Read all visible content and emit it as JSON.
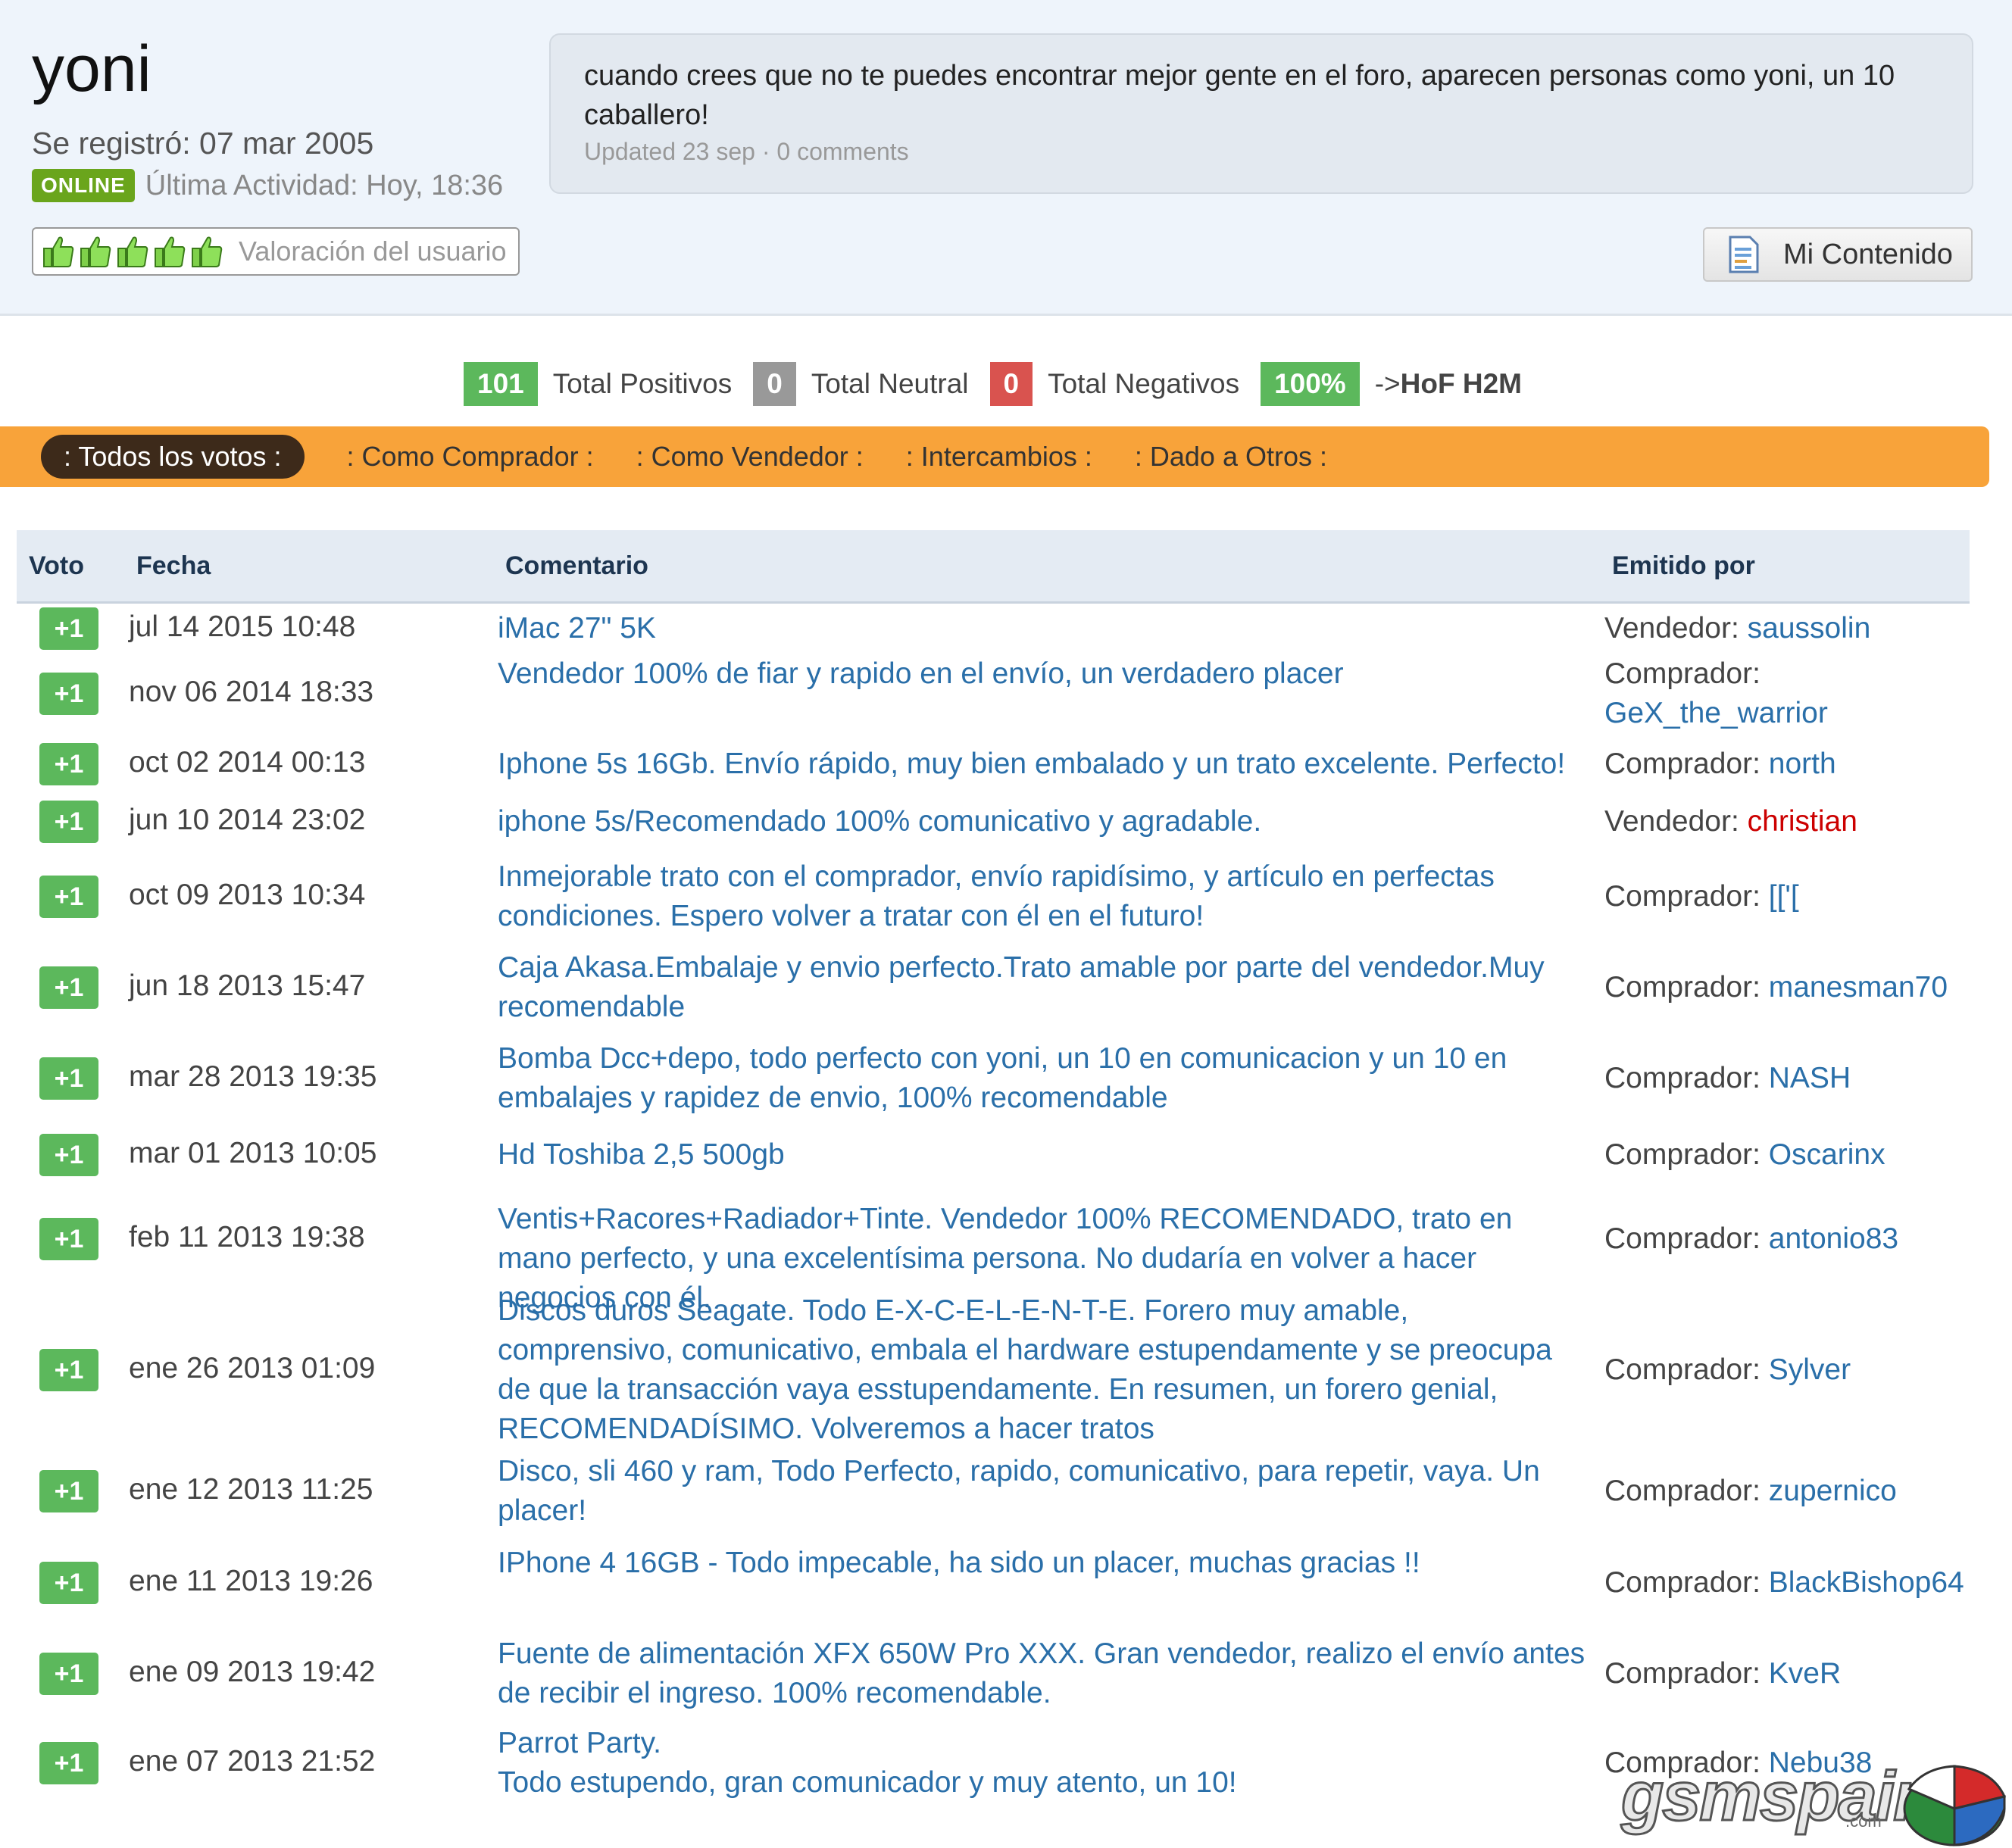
{
  "profile": {
    "username": "yoni",
    "joined": "Se registró: 07 mar 2005",
    "online_badge": "ONLINE",
    "last_activity": "Última Actividad: Hoy, 18:36",
    "rating_label": "Valoración del usuario"
  },
  "status": {
    "text": "cuando crees que no te puedes encontrar mejor gente en el foro, aparecen personas como yoni, un 10 caballero!",
    "meta": "Updated 23 sep · 0 comments"
  },
  "mi_contenido_label": "Mi Contenido",
  "totals": {
    "positive_count": "101",
    "positive_label": "Total Positivos",
    "neutral_count": "0",
    "neutral_label": "Total Neutral",
    "negative_count": "0",
    "negative_label": "Total Negativos",
    "percent": "100%",
    "hof_prefix": "->",
    "hof_label": "HoF H2M"
  },
  "filters": [
    ": Todos los votos :",
    ": Como Comprador :",
    ": Como Vendedor :",
    ": Intercambios :",
    ": Dado a Otros :"
  ],
  "table": {
    "headers": [
      "Voto",
      "Fecha",
      "Comentario",
      "Emitido por"
    ],
    "rows": [
      {
        "vote": "+1",
        "date": "jul 14 2015 10:48",
        "comment": "iMac 27\" 5K",
        "role": "Vendedor: ",
        "user": "saussolin"
      },
      {
        "vote": "+1",
        "date": "nov 06 2014 18:33",
        "comment": "Vendedor 100% de fiar y rapido en el envío, un verdadero placer",
        "role": "Comprador: ",
        "user": "GeX_the_warrior"
      },
      {
        "vote": "+1",
        "date": "oct 02 2014 00:13",
        "comment": "Iphone 5s 16Gb. Envío rápido, muy bien embalado y un trato excelente. Perfecto!",
        "role": "Comprador: ",
        "user": "north"
      },
      {
        "vote": "+1",
        "date": "jun 10 2014 23:02",
        "comment": "iphone 5s/Recomendado 100% comunicativo y agradable.",
        "role": "Vendedor: ",
        "user": "christian"
      },
      {
        "vote": "+1",
        "date": "oct 09 2013 10:34",
        "comment": "Inmejorable trato con el comprador, envío rapidísimo, y artículo en perfectas condiciones. Espero volver a tratar con él en el futuro!",
        "role": "Comprador: ",
        "user": "[['["
      },
      {
        "vote": "+1",
        "date": "jun 18 2013 15:47",
        "comment": "Caja Akasa.Embalaje y envio perfecto.Trato amable por parte del vendedor.Muy recomendable",
        "role": "Comprador: ",
        "user": "manesman70"
      },
      {
        "vote": "+1",
        "date": "mar 28 2013 19:35",
        "comment": "Bomba Dcc+depo, todo perfecto con yoni, un 10 en comunicacion y un 10 en embalajes y rapidez de envio, 100% recomendable",
        "role": "Comprador: ",
        "user": "NASH"
      },
      {
        "vote": "+1",
        "date": "mar 01 2013 10:05",
        "comment": "Hd Toshiba 2,5 500gb",
        "role": "Comprador: ",
        "user": "Oscarinx"
      },
      {
        "vote": "+1",
        "date": "feb 11 2013 19:38",
        "comment": "Ventis+Racores+Radiador+Tinte. Vendedor 100% RECOMENDADO, trato en mano perfecto, y una excelentísima persona. No dudaría en volver a hacer negocios con él.",
        "role": "Comprador: ",
        "user": "antonio83"
      },
      {
        "vote": "+1",
        "date": "ene 26 2013 01:09",
        "comment": "Discos duros Seagate. Todo E-X-C-E-L-E-N-T-E. Forero muy amable, comprensivo, comunicativo, embala el hardware estupendamente y se preocupa de que la transacción vaya esstupendamente. En resumen, un forero genial, RECOMENDADÍSIMO. Volveremos a hacer tratos",
        "role": "Comprador: ",
        "user": "Sylver"
      },
      {
        "vote": "+1",
        "date": "ene 12 2013 11:25",
        "comment": "Disco, sli 460 y ram, Todo Perfecto, rapido, comunicativo, para repetir, vaya. Un placer!",
        "role": "Comprador: ",
        "user": "zupernico"
      },
      {
        "vote": "+1",
        "date": "ene 11 2013 19:26",
        "comment": "IPhone 4 16GB - Todo impecable, ha sido un placer, muchas gracias !!",
        "role": "Comprador: ",
        "user": "BlackBishop64"
      },
      {
        "vote": "+1",
        "date": "ene 09 2013 19:42",
        "comment": "Fuente de alimentación XFX 650W Pro XXX. Gran vendedor, realizo el envío antes de recibir el ingreso. 100% recomendable.",
        "role": "Comprador: ",
        "user": "KveR"
      },
      {
        "vote": "+1",
        "date": "ene 07 2013 21:52",
        "comment": "Parrot Party.\nTodo estupendo, gran comunicador y muy atento, un 10!",
        "role": "Comprador: ",
        "user": "Nebu38"
      }
    ]
  },
  "logo": {
    "text": "gsmspain",
    "sub": ".com"
  },
  "colors": {
    "positive": "#5cb85c",
    "neutral": "#999999",
    "negative": "#d9534f",
    "filter_bar": "#f8a33a",
    "link": "#2a6fa9",
    "red_user": "#cc0000"
  }
}
